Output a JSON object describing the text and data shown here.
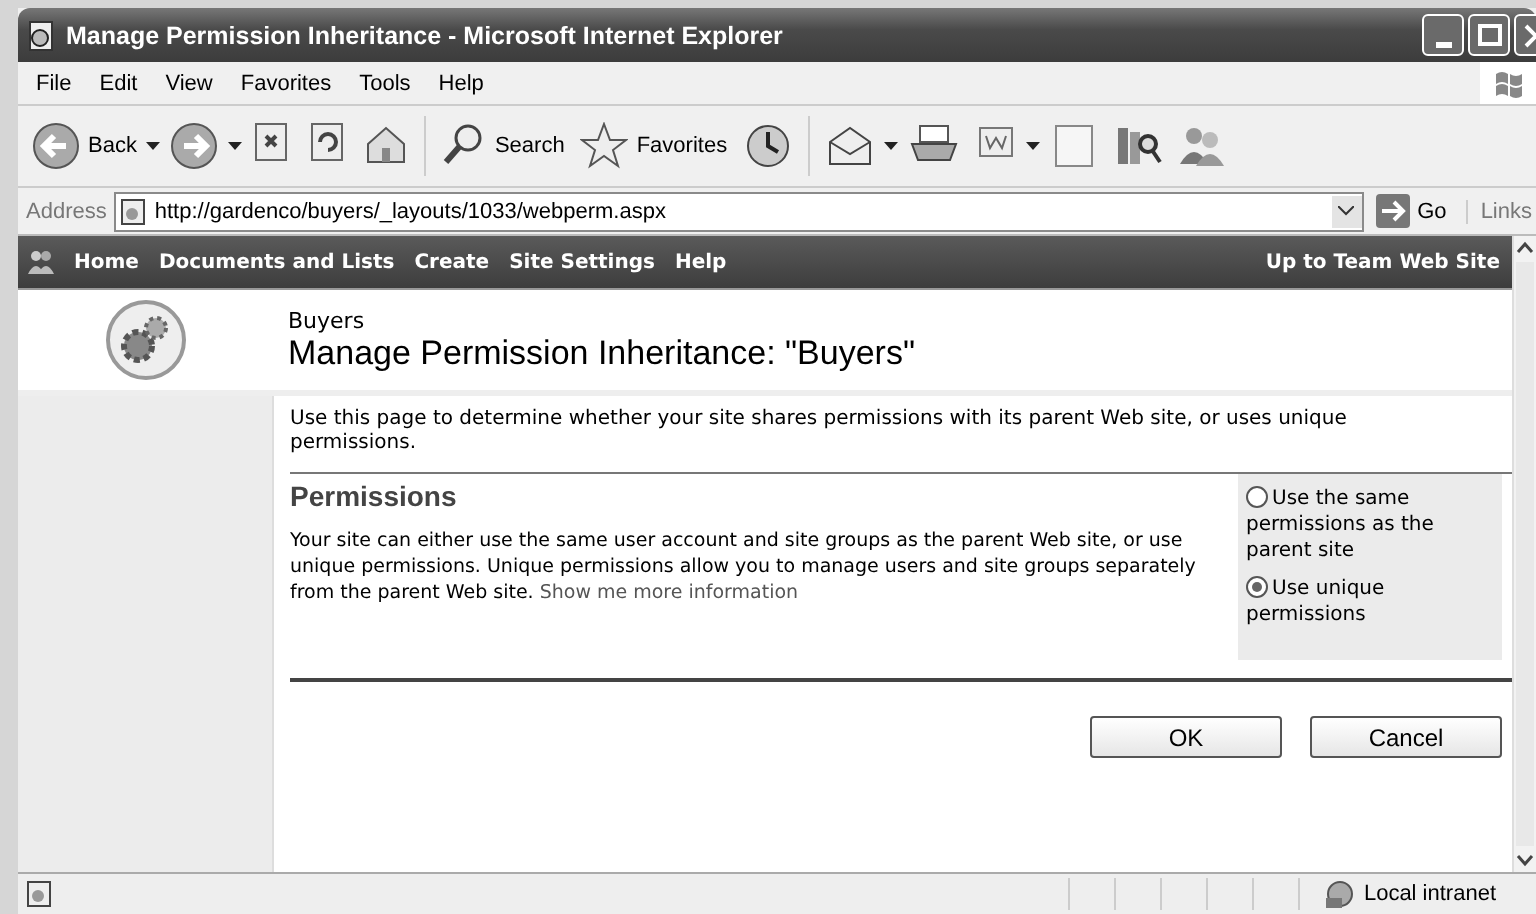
{
  "window": {
    "title": "Manage Permission Inheritance - Microsoft Internet Explorer"
  },
  "menu": [
    "File",
    "Edit",
    "View",
    "Favorites",
    "Tools",
    "Help"
  ],
  "toolbar": [
    {
      "kind": "back",
      "label": "Back"
    },
    {
      "kind": "forward"
    },
    {
      "kind": "stop"
    },
    {
      "kind": "refresh"
    },
    {
      "kind": "home"
    },
    {
      "kind": "search",
      "label": "Search"
    },
    {
      "kind": "favorites",
      "label": "Favorites"
    },
    {
      "kind": "history"
    },
    {
      "kind": "mail"
    },
    {
      "kind": "print"
    },
    {
      "kind": "edit"
    },
    {
      "kind": "note"
    },
    {
      "kind": "research"
    },
    {
      "kind": "messenger"
    }
  ],
  "address": {
    "label": "Address",
    "value": "http://gardenco/buyers/_layouts/1033/webperm.aspx",
    "go": "Go",
    "links": "Links"
  },
  "nav": {
    "items": [
      "Home",
      "Documents and Lists",
      "Create",
      "Site Settings",
      "Help"
    ],
    "right": "Up to Team Web Site"
  },
  "header": {
    "site": "Buyers",
    "title": "Manage Permission Inheritance: \"Buyers\""
  },
  "description": "Use this page to determine whether your site shares permissions with its parent Web site, or uses unique permissions.",
  "section": {
    "heading": "Permissions",
    "text": "Your site can either use the same user account and site groups as the parent Web site, or use unique permissions. Unique permissions allow you to manage users and site groups separately from the parent Web site.",
    "link": "Show me more information"
  },
  "options": [
    {
      "label": "Use the same permissions as the parent site",
      "selected": false
    },
    {
      "label": "Use unique permissions",
      "selected": true
    }
  ],
  "buttons": [
    "OK",
    "Cancel"
  ],
  "status": {
    "zone": "Local intranet"
  }
}
